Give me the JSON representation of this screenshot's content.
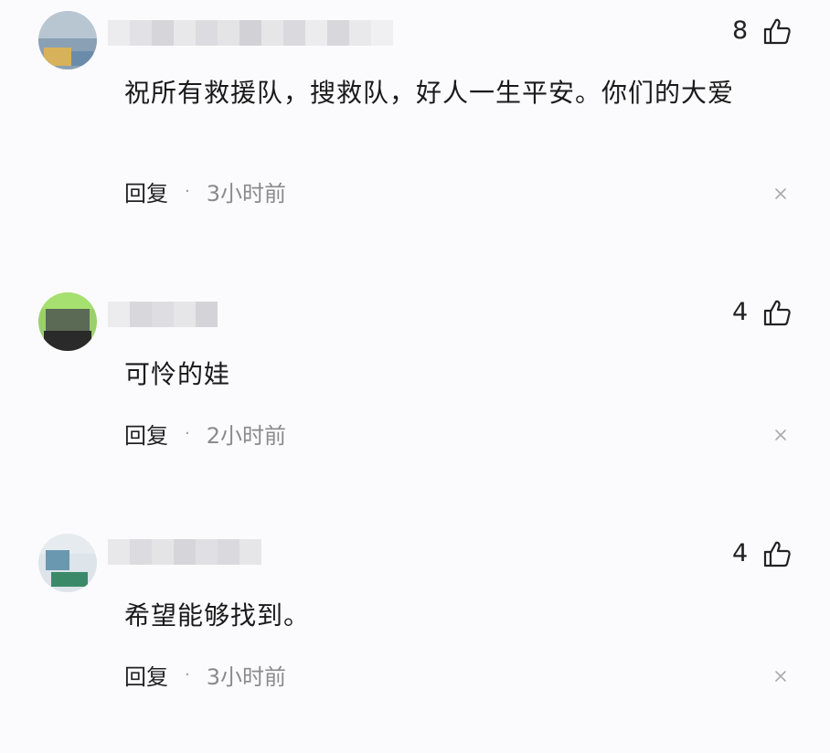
{
  "comments": [
    {
      "content": "祝所有救援队，搜救队，好人一生平安。你们的大爱",
      "likes": "8",
      "reply_label": "回复",
      "separator": "·",
      "time": "3小时前",
      "like_icon": "thumbs-up-icon",
      "dismiss_icon": "close-icon"
    },
    {
      "content": "可怜的娃",
      "likes": "4",
      "reply_label": "回复",
      "separator": "·",
      "time": "2小时前",
      "like_icon": "thumbs-up-icon",
      "dismiss_icon": "close-icon"
    },
    {
      "content": "希望能够找到。",
      "likes": "4",
      "reply_label": "回复",
      "separator": "·",
      "time": "3小时前",
      "like_icon": "thumbs-up-icon",
      "dismiss_icon": "close-icon"
    }
  ]
}
